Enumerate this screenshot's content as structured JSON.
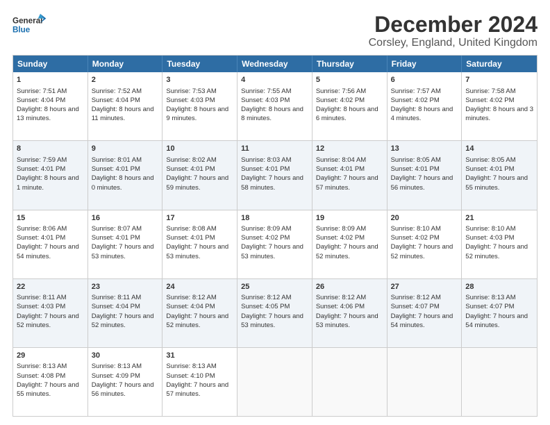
{
  "header": {
    "logo_general": "General",
    "logo_blue": "Blue",
    "title": "December 2024",
    "subtitle": "Corsley, England, United Kingdom"
  },
  "calendar": {
    "days": [
      "Sunday",
      "Monday",
      "Tuesday",
      "Wednesday",
      "Thursday",
      "Friday",
      "Saturday"
    ],
    "rows": [
      [
        {
          "day": "1",
          "sunrise": "Sunrise: 7:51 AM",
          "sunset": "Sunset: 4:04 PM",
          "daylight": "Daylight: 8 hours and 13 minutes."
        },
        {
          "day": "2",
          "sunrise": "Sunrise: 7:52 AM",
          "sunset": "Sunset: 4:04 PM",
          "daylight": "Daylight: 8 hours and 11 minutes."
        },
        {
          "day": "3",
          "sunrise": "Sunrise: 7:53 AM",
          "sunset": "Sunset: 4:03 PM",
          "daylight": "Daylight: 8 hours and 9 minutes."
        },
        {
          "day": "4",
          "sunrise": "Sunrise: 7:55 AM",
          "sunset": "Sunset: 4:03 PM",
          "daylight": "Daylight: 8 hours and 8 minutes."
        },
        {
          "day": "5",
          "sunrise": "Sunrise: 7:56 AM",
          "sunset": "Sunset: 4:02 PM",
          "daylight": "Daylight: 8 hours and 6 minutes."
        },
        {
          "day": "6",
          "sunrise": "Sunrise: 7:57 AM",
          "sunset": "Sunset: 4:02 PM",
          "daylight": "Daylight: 8 hours and 4 minutes."
        },
        {
          "day": "7",
          "sunrise": "Sunrise: 7:58 AM",
          "sunset": "Sunset: 4:02 PM",
          "daylight": "Daylight: 8 hours and 3 minutes."
        }
      ],
      [
        {
          "day": "8",
          "sunrise": "Sunrise: 7:59 AM",
          "sunset": "Sunset: 4:01 PM",
          "daylight": "Daylight: 8 hours and 1 minute."
        },
        {
          "day": "9",
          "sunrise": "Sunrise: 8:01 AM",
          "sunset": "Sunset: 4:01 PM",
          "daylight": "Daylight: 8 hours and 0 minutes."
        },
        {
          "day": "10",
          "sunrise": "Sunrise: 8:02 AM",
          "sunset": "Sunset: 4:01 PM",
          "daylight": "Daylight: 7 hours and 59 minutes."
        },
        {
          "day": "11",
          "sunrise": "Sunrise: 8:03 AM",
          "sunset": "Sunset: 4:01 PM",
          "daylight": "Daylight: 7 hours and 58 minutes."
        },
        {
          "day": "12",
          "sunrise": "Sunrise: 8:04 AM",
          "sunset": "Sunset: 4:01 PM",
          "daylight": "Daylight: 7 hours and 57 minutes."
        },
        {
          "day": "13",
          "sunrise": "Sunrise: 8:05 AM",
          "sunset": "Sunset: 4:01 PM",
          "daylight": "Daylight: 7 hours and 56 minutes."
        },
        {
          "day": "14",
          "sunrise": "Sunrise: 8:05 AM",
          "sunset": "Sunset: 4:01 PM",
          "daylight": "Daylight: 7 hours and 55 minutes."
        }
      ],
      [
        {
          "day": "15",
          "sunrise": "Sunrise: 8:06 AM",
          "sunset": "Sunset: 4:01 PM",
          "daylight": "Daylight: 7 hours and 54 minutes."
        },
        {
          "day": "16",
          "sunrise": "Sunrise: 8:07 AM",
          "sunset": "Sunset: 4:01 PM",
          "daylight": "Daylight: 7 hours and 53 minutes."
        },
        {
          "day": "17",
          "sunrise": "Sunrise: 8:08 AM",
          "sunset": "Sunset: 4:01 PM",
          "daylight": "Daylight: 7 hours and 53 minutes."
        },
        {
          "day": "18",
          "sunrise": "Sunrise: 8:09 AM",
          "sunset": "Sunset: 4:02 PM",
          "daylight": "Daylight: 7 hours and 53 minutes."
        },
        {
          "day": "19",
          "sunrise": "Sunrise: 8:09 AM",
          "sunset": "Sunset: 4:02 PM",
          "daylight": "Daylight: 7 hours and 52 minutes."
        },
        {
          "day": "20",
          "sunrise": "Sunrise: 8:10 AM",
          "sunset": "Sunset: 4:02 PM",
          "daylight": "Daylight: 7 hours and 52 minutes."
        },
        {
          "day": "21",
          "sunrise": "Sunrise: 8:10 AM",
          "sunset": "Sunset: 4:03 PM",
          "daylight": "Daylight: 7 hours and 52 minutes."
        }
      ],
      [
        {
          "day": "22",
          "sunrise": "Sunrise: 8:11 AM",
          "sunset": "Sunset: 4:03 PM",
          "daylight": "Daylight: 7 hours and 52 minutes."
        },
        {
          "day": "23",
          "sunrise": "Sunrise: 8:11 AM",
          "sunset": "Sunset: 4:04 PM",
          "daylight": "Daylight: 7 hours and 52 minutes."
        },
        {
          "day": "24",
          "sunrise": "Sunrise: 8:12 AM",
          "sunset": "Sunset: 4:04 PM",
          "daylight": "Daylight: 7 hours and 52 minutes."
        },
        {
          "day": "25",
          "sunrise": "Sunrise: 8:12 AM",
          "sunset": "Sunset: 4:05 PM",
          "daylight": "Daylight: 7 hours and 53 minutes."
        },
        {
          "day": "26",
          "sunrise": "Sunrise: 8:12 AM",
          "sunset": "Sunset: 4:06 PM",
          "daylight": "Daylight: 7 hours and 53 minutes."
        },
        {
          "day": "27",
          "sunrise": "Sunrise: 8:12 AM",
          "sunset": "Sunset: 4:07 PM",
          "daylight": "Daylight: 7 hours and 54 minutes."
        },
        {
          "day": "28",
          "sunrise": "Sunrise: 8:13 AM",
          "sunset": "Sunset: 4:07 PM",
          "daylight": "Daylight: 7 hours and 54 minutes."
        }
      ],
      [
        {
          "day": "29",
          "sunrise": "Sunrise: 8:13 AM",
          "sunset": "Sunset: 4:08 PM",
          "daylight": "Daylight: 7 hours and 55 minutes."
        },
        {
          "day": "30",
          "sunrise": "Sunrise: 8:13 AM",
          "sunset": "Sunset: 4:09 PM",
          "daylight": "Daylight: 7 hours and 56 minutes."
        },
        {
          "day": "31",
          "sunrise": "Sunrise: 8:13 AM",
          "sunset": "Sunset: 4:10 PM",
          "daylight": "Daylight: 7 hours and 57 minutes."
        },
        null,
        null,
        null,
        null
      ]
    ]
  }
}
